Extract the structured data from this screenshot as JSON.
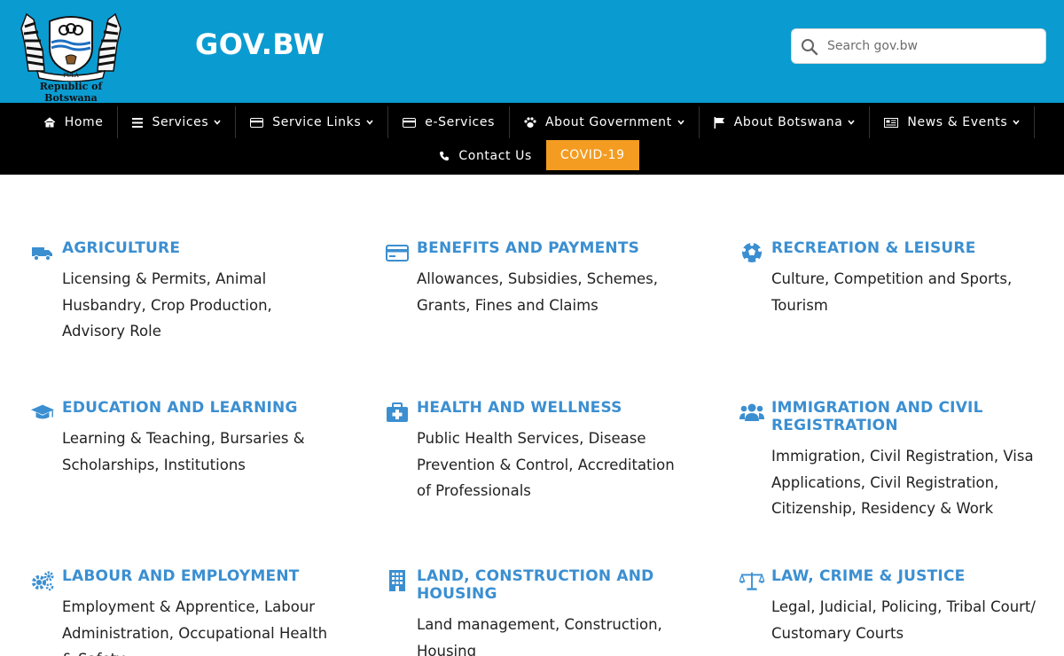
{
  "header": {
    "logo_caption": "Republic of Botswana",
    "logo_motto": "PULA",
    "site_title": "GOV.BW",
    "search": {
      "placeholder": "Search gov.bw",
      "icon": "search-icon"
    },
    "colors": {
      "header_bg": "#0a9bd1",
      "nav_bg": "#000000",
      "accent": "#f39c21",
      "link": "#3b8fd1"
    }
  },
  "nav": {
    "row1": [
      {
        "label": "Home",
        "icon": "home-icon",
        "dropdown": false
      },
      {
        "label": "Services",
        "icon": "list-icon",
        "dropdown": true
      },
      {
        "label": "Service Links",
        "icon": "card-icon",
        "dropdown": true
      },
      {
        "label": "e-Services",
        "icon": "card-icon",
        "dropdown": false
      },
      {
        "label": "About Government",
        "icon": "paw-icon",
        "dropdown": true
      },
      {
        "label": "About Botswana",
        "icon": "flag-icon",
        "dropdown": true
      },
      {
        "label": "News & Events",
        "icon": "newspaper-icon",
        "dropdown": true
      }
    ],
    "row2": [
      {
        "label": "Contact Us",
        "icon": "phone-icon",
        "dropdown": false
      },
      {
        "label": "COVID-19",
        "icon": "",
        "dropdown": false
      }
    ]
  },
  "categories": [
    {
      "title": "AGRICULTURE",
      "desc": "Licensing & Permits, Animal Husbandry, Crop Production, Advisory Role",
      "icon": "truck-icon"
    },
    {
      "title": "BENEFITS AND PAYMENTS",
      "desc": "Allowances, Subsidies, Schemes, Grants, Fines and Claims",
      "icon": "credit-card-icon"
    },
    {
      "title": "RECREATION & LEISURE",
      "desc": "Culture, Competition and Sports, Tourism",
      "icon": "soccer-ball-icon"
    },
    {
      "title": "EDUCATION AND LEARNING",
      "desc": "Learning & Teaching, Bursaries & Scholarships, Institutions",
      "icon": "graduation-cap-icon"
    },
    {
      "title": "HEALTH AND WELLNESS",
      "desc": "Public Health Services, Disease Prevention & Control, Accreditation of Professionals",
      "icon": "medkit-icon"
    },
    {
      "title": "IMMIGRATION AND CIVIL REGISTRATION",
      "desc": "Immigration, Civil Registration, Visa Applications, Civil Registration, Citizenship, Residency & Work",
      "icon": "users-icon"
    },
    {
      "title": "LABOUR AND EMPLOYMENT",
      "desc": "Employment & Apprentice, Labour Administration, Occupational Health & Safety",
      "icon": "cogs-icon"
    },
    {
      "title": "LAND, CONSTRUCTION AND HOUSING",
      "desc": "Land management, Construction, Housing",
      "icon": "building-icon"
    },
    {
      "title": "LAW, CRIME & JUSTICE",
      "desc": "Legal, Judicial, Policing, Tribal Court/ Customary Courts",
      "icon": "balance-scale-icon"
    }
  ]
}
